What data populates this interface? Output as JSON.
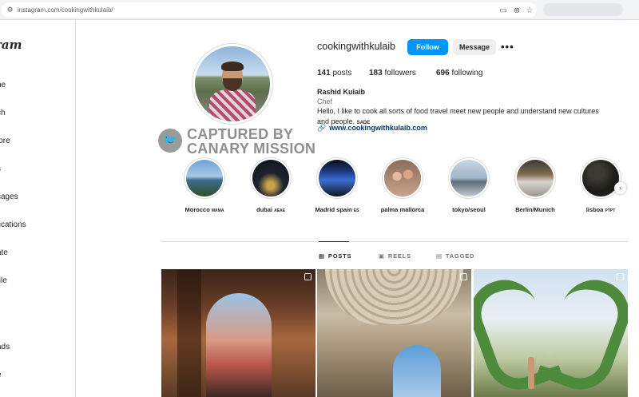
{
  "browser": {
    "url": "instagram.com/cookingwithkulaib/",
    "icons": [
      "site-settings-icon",
      "screen-cast-icon",
      "zoom-icon",
      "bookmark-star-icon"
    ]
  },
  "sidebar": {
    "logo": "ram",
    "items": [
      {
        "label": "ne",
        "name": "home"
      },
      {
        "label": "ch",
        "name": "search"
      },
      {
        "label": "lore",
        "name": "explore"
      },
      {
        "label": "s",
        "name": "reels"
      },
      {
        "label": "sages",
        "name": "messages"
      },
      {
        "label": "fications",
        "name": "notifications"
      },
      {
        "label": "ate",
        "name": "create"
      },
      {
        "label": "file",
        "name": "profile"
      },
      {
        "label": "ads",
        "name": "threads"
      },
      {
        "label": "e",
        "name": "more"
      }
    ]
  },
  "watermark": {
    "line1": "CAPTURED BY",
    "line2": "CANARY MISSION"
  },
  "profile": {
    "username": "cookingwithkulaib",
    "follow_label": "Follow",
    "message_label": "Message",
    "more_label": "•••",
    "posts_count": "141",
    "posts_label": "posts",
    "followers_count": "183",
    "followers_label": "followers",
    "following_count": "696",
    "following_label": "following",
    "full_name": "Rashid Kulaib",
    "category": "Chef",
    "bio": "Hello, I like to cook all sorts of food travel meet new people and understand new cultures and people.",
    "bio_flag": "SADE",
    "link": "www.cookingwithkulaib.com"
  },
  "highlights": [
    {
      "label": "Morocco",
      "flag": "MAMA"
    },
    {
      "label": "dubai",
      "flag": "AEAE"
    },
    {
      "label": "Madrid spain",
      "flag": "ES"
    },
    {
      "label": "palma mallorca",
      "flag": ""
    },
    {
      "label": "tokyo/seoul",
      "flag": ""
    },
    {
      "label": "Berlin/Munich",
      "flag": ""
    },
    {
      "label": "lisboa",
      "flag": "PTPT"
    }
  ],
  "tabs": [
    {
      "label": "POSTS",
      "icon": "grid-icon",
      "active": true
    },
    {
      "label": "REELS",
      "icon": "reels-icon",
      "active": false
    },
    {
      "label": "TAGGED",
      "icon": "tagged-icon",
      "active": false
    }
  ],
  "colors": {
    "follow_button": "#0095f6",
    "link": "#00376b",
    "border": "#dbdbdb"
  }
}
